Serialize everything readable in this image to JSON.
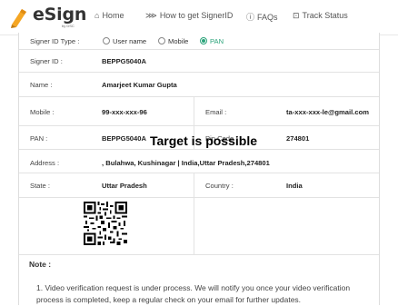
{
  "header": {
    "logo_text": "eSign",
    "logo_sub": "by DSC",
    "nav": [
      {
        "label": "Home",
        "icon": "home-icon"
      },
      {
        "label": "How to get SignerID",
        "icon": "steps-icon"
      },
      {
        "label": "FAQs",
        "icon": "help-icon"
      },
      {
        "label": "Track Status",
        "icon": "track-icon"
      }
    ]
  },
  "form": {
    "signer_id_type": {
      "label": "Signer ID Type :",
      "options": [
        "User name",
        "Mobile",
        "PAN"
      ],
      "selected": "PAN"
    },
    "signer_id": {
      "label": "Signer ID :",
      "value": "BEPPG5040A"
    },
    "name": {
      "label": "Name :",
      "value": "Amarjeet Kumar Gupta"
    },
    "mobile": {
      "label": "Mobile :",
      "value": "99-xxx-xxx-96"
    },
    "email": {
      "label": "Email :",
      "value": "ta-xxx-xxx-le@gmail.com"
    },
    "pan": {
      "label": "PAN :",
      "value": "BEPPG5040A"
    },
    "pin_code": {
      "label": "Pin Code :",
      "value": "274801"
    },
    "address": {
      "label": "Address :",
      "value": ", Bulahwa, Kushinagar | India,Uttar Pradesh,274801"
    },
    "state": {
      "label": "State :",
      "value": "Uttar Pradesh"
    },
    "country": {
      "label": "Country :",
      "value": "India"
    }
  },
  "overlay": "Target is possible",
  "note": {
    "title": "Note :",
    "items": [
      "1. Video verification request is under process. We will notify you once your video verification process is completed, keep a regular check on your email for further updates."
    ]
  },
  "colors": {
    "accent_green": "#2aa37a",
    "logo_orange": "#f5a623"
  }
}
